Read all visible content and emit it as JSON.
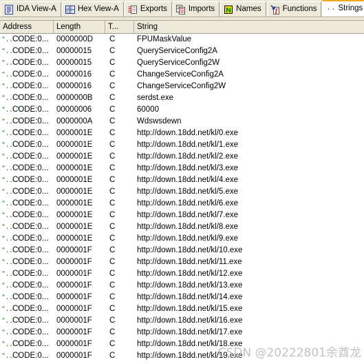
{
  "tabs": [
    {
      "label": "IDA View-A",
      "icon": "document-listing-icon",
      "active": false
    },
    {
      "label": "Hex View-A",
      "icon": "hex-grid-icon",
      "active": false
    },
    {
      "label": "Exports",
      "icon": "exports-arrow-icon",
      "active": false
    },
    {
      "label": "Imports",
      "icon": "imports-arrow-icon",
      "active": false
    },
    {
      "label": "Names",
      "icon": "names-n-icon",
      "active": false
    },
    {
      "label": "Functions",
      "icon": "functions-f-icon",
      "active": false
    },
    {
      "label": "Strings",
      "icon": "strings-quote-icon",
      "active": true
    }
  ],
  "columns": [
    {
      "key": "address",
      "label": "Address"
    },
    {
      "key": "length",
      "label": "Length"
    },
    {
      "key": "type",
      "label": "T..."
    },
    {
      "key": "string",
      "label": "String"
    }
  ],
  "colors": {
    "active_tab_top_border": "#f5a623",
    "chrome_background": "#ece9d8",
    "table_background": "#ffffff",
    "icon_green": "#1f7a1f",
    "text": "#000000",
    "watermark": "#b8b8b8"
  },
  "rows": [
    {
      "icon": "string-quote-icon",
      "address": "CODE:0...",
      "length": "0000000D",
      "type": "C",
      "string": "FPUMaskValue"
    },
    {
      "icon": "string-quote-icon",
      "address": "CODE:0...",
      "length": "00000015",
      "type": "C",
      "string": "QueryServiceConfig2A"
    },
    {
      "icon": "string-quote-icon",
      "address": "CODE:0...",
      "length": "00000015",
      "type": "C",
      "string": "QueryServiceConfig2W"
    },
    {
      "icon": "string-quote-icon",
      "address": "CODE:0...",
      "length": "00000016",
      "type": "C",
      "string": "ChangeServiceConfig2A"
    },
    {
      "icon": "string-quote-icon",
      "address": "CODE:0...",
      "length": "00000016",
      "type": "C",
      "string": "ChangeServiceConfig2W"
    },
    {
      "icon": "string-quote-icon",
      "address": "CODE:0...",
      "length": "0000000B",
      "type": "C",
      "string": "serdst.exe"
    },
    {
      "icon": "string-quote-icon",
      "address": "CODE:0...",
      "length": "00000006",
      "type": "C",
      "string": "60000"
    },
    {
      "icon": "string-quote-icon",
      "address": "CODE:0...",
      "length": "0000000A",
      "type": "C",
      "string": "Wdswsdewn"
    },
    {
      "icon": "string-quote-icon",
      "address": "CODE:0...",
      "length": "0000001E",
      "type": "C",
      "string": "http://down.18dd.net/kl/0.exe"
    },
    {
      "icon": "string-quote-icon",
      "address": "CODE:0...",
      "length": "0000001E",
      "type": "C",
      "string": "http://down.18dd.net/kl/1.exe"
    },
    {
      "icon": "string-quote-icon",
      "address": "CODE:0...",
      "length": "0000001E",
      "type": "C",
      "string": "http://down.18dd.net/kl/2.exe"
    },
    {
      "icon": "string-quote-icon",
      "address": "CODE:0...",
      "length": "0000001E",
      "type": "C",
      "string": "http://down.18dd.net/kl/3.exe"
    },
    {
      "icon": "string-quote-icon",
      "address": "CODE:0...",
      "length": "0000001E",
      "type": "C",
      "string": "http://down.18dd.net/kl/4.exe"
    },
    {
      "icon": "string-quote-icon",
      "address": "CODE:0...",
      "length": "0000001E",
      "type": "C",
      "string": "http://down.18dd.net/kl/5.exe"
    },
    {
      "icon": "string-quote-icon",
      "address": "CODE:0...",
      "length": "0000001E",
      "type": "C",
      "string": "http://down.18dd.net/kl/6.exe"
    },
    {
      "icon": "string-quote-icon",
      "address": "CODE:0...",
      "length": "0000001E",
      "type": "C",
      "string": "http://down.18dd.net/kl/7.exe"
    },
    {
      "icon": "string-quote-icon",
      "address": "CODE:0...",
      "length": "0000001E",
      "type": "C",
      "string": "http://down.18dd.net/kl/8.exe"
    },
    {
      "icon": "string-quote-icon",
      "address": "CODE:0...",
      "length": "0000001E",
      "type": "C",
      "string": "http://down.18dd.net/kl/9.exe"
    },
    {
      "icon": "string-quote-icon",
      "address": "CODE:0...",
      "length": "0000001F",
      "type": "C",
      "string": "http://down.18dd.net/kl/10.exe"
    },
    {
      "icon": "string-quote-icon",
      "address": "CODE:0...",
      "length": "0000001F",
      "type": "C",
      "string": "http://down.18dd.net/kl/11.exe"
    },
    {
      "icon": "string-quote-icon",
      "address": "CODE:0...",
      "length": "0000001F",
      "type": "C",
      "string": "http://down.18dd.net/kl/12.exe"
    },
    {
      "icon": "string-quote-icon",
      "address": "CODE:0...",
      "length": "0000001F",
      "type": "C",
      "string": "http://down.18dd.net/kl/13.exe"
    },
    {
      "icon": "string-quote-icon",
      "address": "CODE:0...",
      "length": "0000001F",
      "type": "C",
      "string": "http://down.18dd.net/kl/14.exe"
    },
    {
      "icon": "string-quote-icon",
      "address": "CODE:0...",
      "length": "0000001F",
      "type": "C",
      "string": "http://down.18dd.net/kl/15.exe"
    },
    {
      "icon": "string-quote-icon",
      "address": "CODE:0...",
      "length": "0000001F",
      "type": "C",
      "string": "http://down.18dd.net/kl/16.exe"
    },
    {
      "icon": "string-quote-icon",
      "address": "CODE:0...",
      "length": "0000001F",
      "type": "C",
      "string": "http://down.18dd.net/kl/17.exe"
    },
    {
      "icon": "string-quote-icon",
      "address": "CODE:0...",
      "length": "0000001F",
      "type": "C",
      "string": "http://down.18dd.net/kl/18.exe"
    },
    {
      "icon": "string-quote-icon",
      "address": "CODE:0...",
      "length": "0000001F",
      "type": "C",
      "string": "http://down.18dd.net/kl/19.exe"
    }
  ],
  "watermark": {
    "text": "CSDN @20222801余酋龙"
  }
}
